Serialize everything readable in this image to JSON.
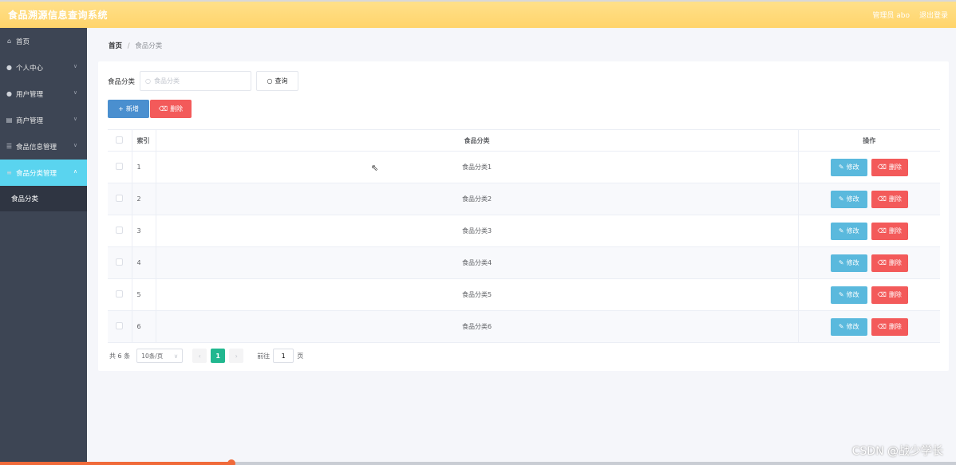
{
  "header": {
    "title": "食品溯源信息查询系统",
    "admin_label": "管理员 abo",
    "logout_label": "退出登录"
  },
  "sidebar": {
    "items": [
      {
        "label": "首页",
        "icon": "home-icon",
        "has_children": false
      },
      {
        "label": "个人中心",
        "icon": "user-icon",
        "has_children": true
      },
      {
        "label": "用户管理",
        "icon": "user-icon",
        "has_children": true
      },
      {
        "label": "商户管理",
        "icon": "shop-icon",
        "has_children": true
      },
      {
        "label": "食品信息管理",
        "icon": "list-icon",
        "has_children": true
      },
      {
        "label": "食品分类管理",
        "icon": "menu-icon",
        "has_children": true,
        "active": true
      }
    ],
    "sub_item": "食品分类"
  },
  "breadcrumb": {
    "home": "首页",
    "separator": "/",
    "current": "食品分类"
  },
  "search": {
    "label": "食品分类",
    "placeholder": "食品分类",
    "query_label": "查询"
  },
  "actions": {
    "add_label": "新增",
    "delete_label": "删除"
  },
  "table": {
    "headers": {
      "index": "索引",
      "category": "食品分类",
      "operation": "操作"
    },
    "edit_label": "修改",
    "delete_label": "删除",
    "rows": [
      {
        "index": "1",
        "category": "食品分类1"
      },
      {
        "index": "2",
        "category": "食品分类2"
      },
      {
        "index": "3",
        "category": "食品分类3"
      },
      {
        "index": "4",
        "category": "食品分类4"
      },
      {
        "index": "5",
        "category": "食品分类5"
      },
      {
        "index": "6",
        "category": "食品分类6"
      }
    ]
  },
  "pagination": {
    "total": "共 6 条",
    "page_size": "10条/页",
    "current_page": "1",
    "goto_prefix": "前往",
    "goto_value": "1",
    "goto_suffix": "页"
  },
  "watermark": "CSDN @战少学长",
  "colors": {
    "header": "#ffd46b",
    "sidebar": "#3d4554",
    "sidebar_active": "#5ad4ef",
    "add": "#4a8fcf",
    "delete": "#f35a5a",
    "edit": "#5ab9dd",
    "page_active": "#21b78f"
  }
}
